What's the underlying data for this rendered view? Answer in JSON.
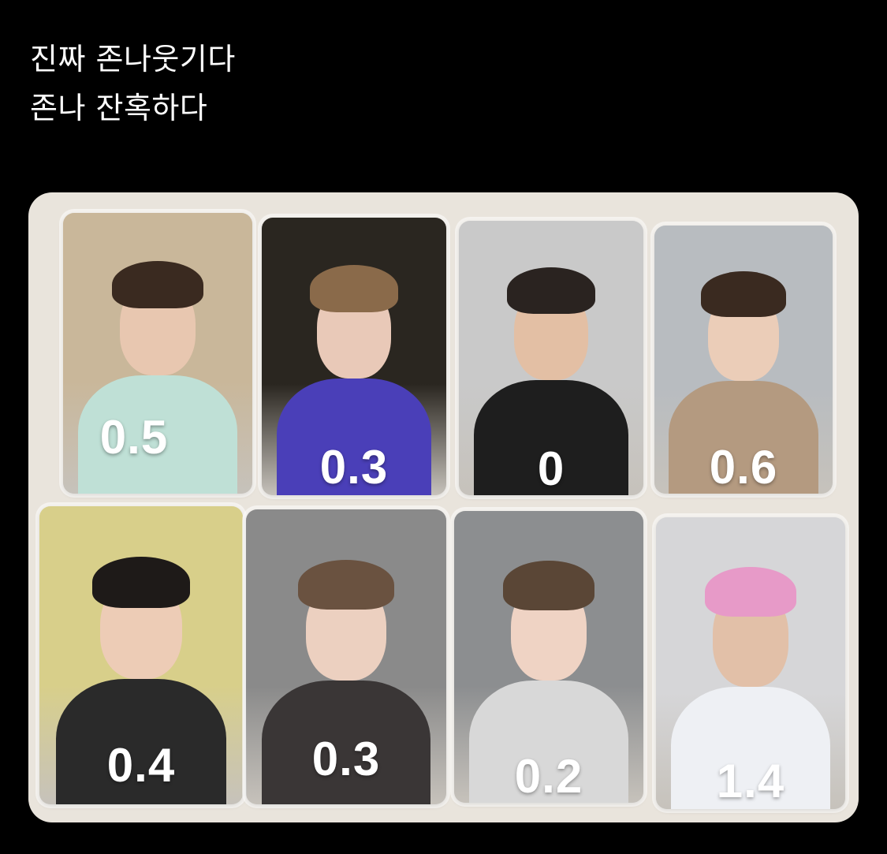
{
  "post": {
    "caption_lines": [
      "진짜 존나웃기다",
      "존나 잔혹하다"
    ]
  },
  "media": {
    "cards": [
      {
        "rating": "0.5",
        "bg": "#c9b79a",
        "hair": "#3a2a20",
        "skin": "#e8c7b0",
        "shirt": "#bfe0d6"
      },
      {
        "rating": "0.3",
        "bg": "#2a2620",
        "hair": "#8a6a4a",
        "skin": "#e9c9b8",
        "shirt": "#4a3fb8"
      },
      {
        "rating": "0",
        "bg": "#c9c9c9",
        "hair": "#2a2320",
        "skin": "#e3bfa4",
        "shirt": "#1e1e1e"
      },
      {
        "rating": "0.6",
        "bg": "#b8bcc0",
        "hair": "#3a2a20",
        "skin": "#ebcdb8",
        "shirt": "#b49a80"
      },
      {
        "rating": "0.4",
        "bg": "#d8cf8a",
        "hair": "#1e1a18",
        "skin": "#edccb6",
        "shirt": "#2a2a2a"
      },
      {
        "rating": "0.3",
        "bg": "#8a8a8a",
        "hair": "#6a5240",
        "skin": "#ecd0c0",
        "shirt": "#3a3636"
      },
      {
        "rating": "0.2",
        "bg": "#8c8e90",
        "hair": "#5a4636",
        "skin": "#efd3c4",
        "shirt": "#d8d8d8"
      },
      {
        "rating": "1.4",
        "bg": "#d6d6d8",
        "hair": "#e79ac8",
        "skin": "#e2c0a8",
        "shirt": "#eef0f4"
      }
    ]
  }
}
